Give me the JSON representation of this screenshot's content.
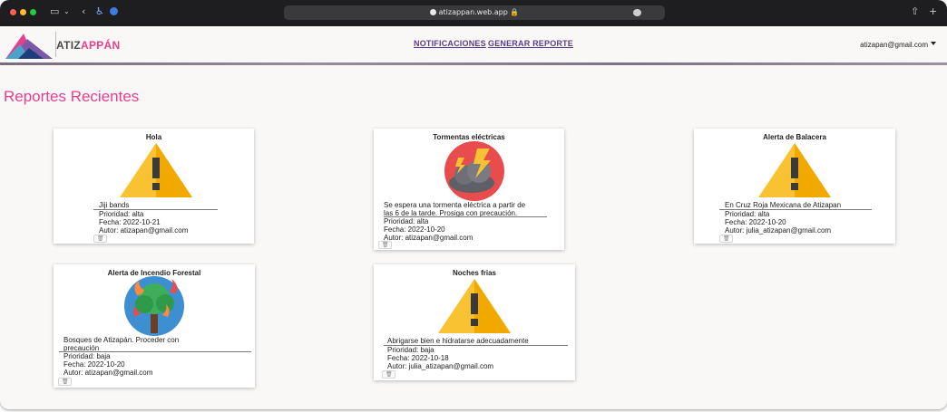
{
  "browser": {
    "url": "atizappan.web.app",
    "colors": {
      "close": "#ff5f57",
      "minimize": "#febc2e",
      "zoom": "#28c840"
    }
  },
  "header": {
    "brand_part1": "ATIZ",
    "brand_part2": "APPÁN",
    "nav": [
      "NOTIFICACIONES",
      "GENERAR REPORTE"
    ],
    "user_email": "atizapan@gmail.com",
    "accent": "#e83e8c",
    "nav_color": "#5a3e8c"
  },
  "page": {
    "title": "Reportes Recientes"
  },
  "reports": [
    {
      "title": "Hola",
      "icon": "warning-icon",
      "description": [
        "Jiji bands"
      ],
      "priority": "Prioridad: alta",
      "date": "Fecha: 2022-10-21",
      "author": "Autor: atizapan@gmail.com"
    },
    {
      "title": "Tormentas eléctricas",
      "icon": "storm-icon",
      "description": [
        "Se espera una tormenta eléctrica a partir de",
        "las 6 de la tarde. Prosiga con precaución."
      ],
      "priority": "Prioridad: alta",
      "date": "Fecha: 2022-10-20",
      "author": "Autor: atizapan@gmail.com"
    },
    {
      "title": "Alerta de Balacera",
      "icon": "warning-icon",
      "description": [
        "En Cruz Roja Mexicana de Atizapan"
      ],
      "priority": "Prioridad: alta",
      "date": "Fecha: 2022-10-20",
      "author": "Autor: julia_atizapan@gmail.com"
    },
    {
      "title": "Alerta de Incendio Forestal",
      "icon": "forest-fire-icon",
      "description": [
        "Bosques de Atizapán. Proceder con",
        "precaución"
      ],
      "priority": "Prioridad: baja",
      "date": "Fecha: 2022-10-20",
      "author": "Autor: atizapan@gmail.com"
    },
    {
      "title": "Noches frias",
      "icon": "warning-icon",
      "description": [
        "Abrigarse bien e hidratarse adecuadamente"
      ],
      "priority": "Prioridad: baja",
      "date": "Fecha: 2022-10-18",
      "author": "Autor: julia_atizapan@gmail.com"
    }
  ]
}
